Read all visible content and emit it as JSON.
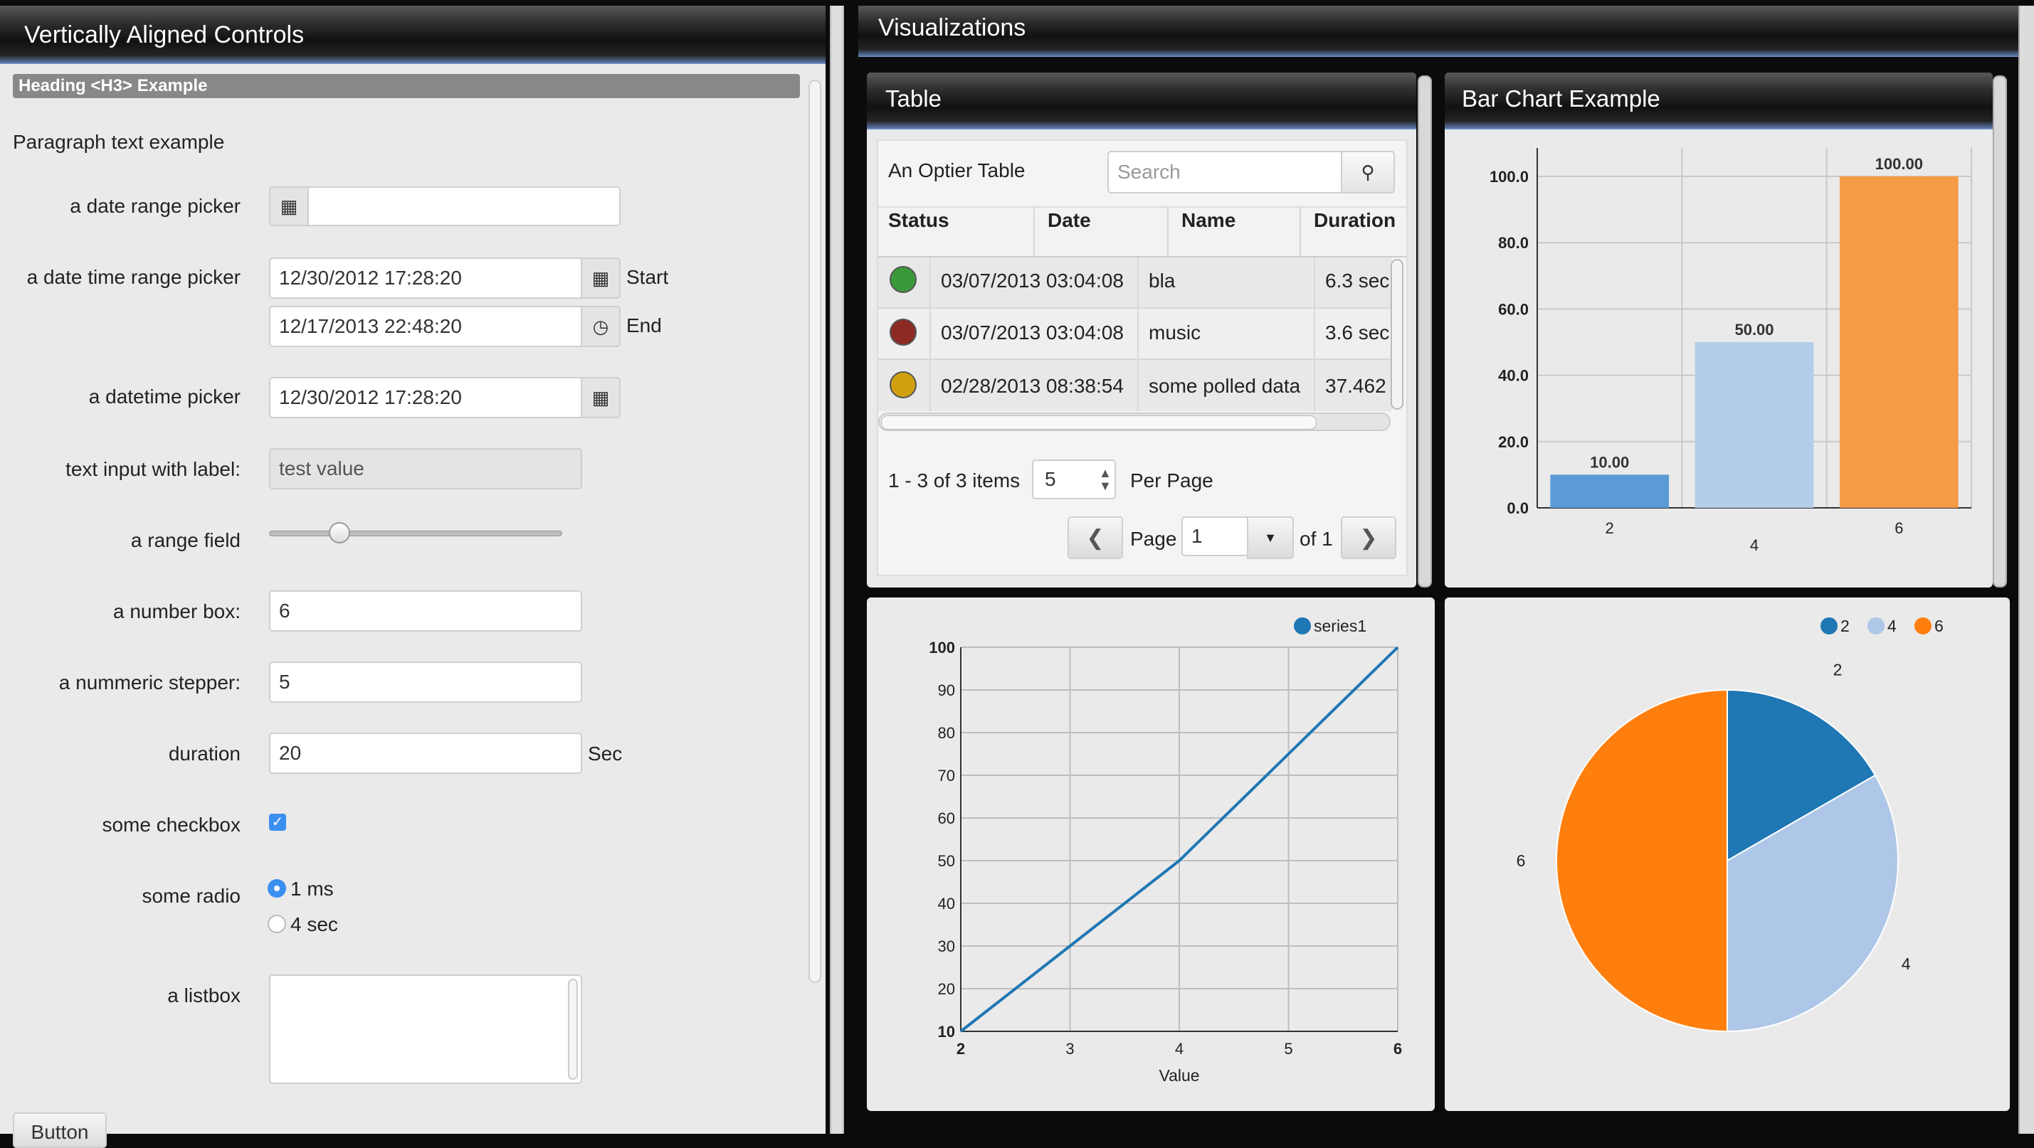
{
  "left_panel": {
    "title": "Vertically Aligned Controls",
    "heading": "Heading <H3> Example",
    "paragraph": "Paragraph text example",
    "fields": {
      "date_range": {
        "label": "a date range picker",
        "value": ""
      },
      "date_time_range": {
        "label": "a date time range picker",
        "start_value": "12/30/2012 17:28:20",
        "start_label": "Start",
        "end_value": "12/17/2013 22:48:20",
        "end_label": "End"
      },
      "datetime": {
        "label": "a datetime picker",
        "value": "12/30/2012 17:28:20"
      },
      "text_input": {
        "label": "text input with label:",
        "value": "test value"
      },
      "range": {
        "label": "a range field",
        "value_fraction": 0.24
      },
      "number_box": {
        "label": "a number box:",
        "value": "6"
      },
      "stepper": {
        "label": "a nummeric stepper:",
        "value": "5"
      },
      "duration": {
        "label": "duration",
        "value": "20",
        "unit": "Sec"
      },
      "checkbox": {
        "label": "some checkbox",
        "checked": true
      },
      "radio": {
        "label": "some radio",
        "options": [
          "1 ms",
          "4 sec"
        ],
        "selected": "1 ms"
      },
      "listbox": {
        "label": "a listbox"
      }
    },
    "button_label": "Button"
  },
  "visualizations": {
    "title": "Visualizations",
    "table_panel": {
      "title": "Table",
      "table_title": "An Optier Table",
      "search_placeholder": "Search",
      "columns": [
        "Status",
        "Date",
        "Name",
        "Duration"
      ],
      "rows": [
        {
          "status_color": "#3a9a3a",
          "date": "03/07/2013 03:04:08",
          "name": "bla",
          "duration": "6.3 sec"
        },
        {
          "status_color": "#8e2a24",
          "date": "03/07/2013 03:04:08",
          "name": "music",
          "duration": "3.6 sec"
        },
        {
          "status_color": "#d0a010",
          "date": "02/28/2013 08:38:54",
          "name": "some polled data",
          "duration": "37.462"
        }
      ],
      "items_text": "1 - 3 of 3 items",
      "per_page_value": "5",
      "per_page_label": "Per Page",
      "page_label": "Page",
      "page_value": "1",
      "of_text": "of 1"
    },
    "bar_panel": {
      "title": "Bar Chart Example"
    }
  },
  "chart_data": [
    {
      "type": "bar",
      "title": "Bar Chart Example",
      "categories": [
        "2",
        "4",
        "6"
      ],
      "values": [
        10,
        50,
        100
      ],
      "value_labels": [
        "10.00",
        "50.00",
        "100.00"
      ],
      "colors": [
        "#5b9bd5",
        "#b3cde8",
        "#f59a45"
      ],
      "ylim": [
        0,
        100
      ],
      "yticks": [
        "0.0",
        "20.0",
        "40.0",
        "60.0",
        "80.0",
        "100.0"
      ],
      "grid": true
    },
    {
      "type": "line",
      "series": [
        {
          "name": "series1",
          "x": [
            2,
            3,
            4,
            5,
            6
          ],
          "values": [
            10,
            30,
            50,
            75,
            100
          ]
        }
      ],
      "xlabel": "Value",
      "xlim": [
        2,
        6
      ],
      "ylim": [
        10,
        100
      ],
      "xticks": [
        "2",
        "3",
        "4",
        "5",
        "6"
      ],
      "yticks": [
        "10",
        "20",
        "30",
        "40",
        "50",
        "60",
        "70",
        "80",
        "90",
        "100"
      ],
      "color": "#1f77b4",
      "legend": "top-right",
      "grid": true
    },
    {
      "type": "pie",
      "categories": [
        "2",
        "4",
        "6"
      ],
      "values": [
        2,
        4,
        6
      ],
      "colors": [
        "#1f77b4",
        "#aec7e8",
        "#ff7f0e"
      ],
      "legend": "top-right"
    }
  ]
}
